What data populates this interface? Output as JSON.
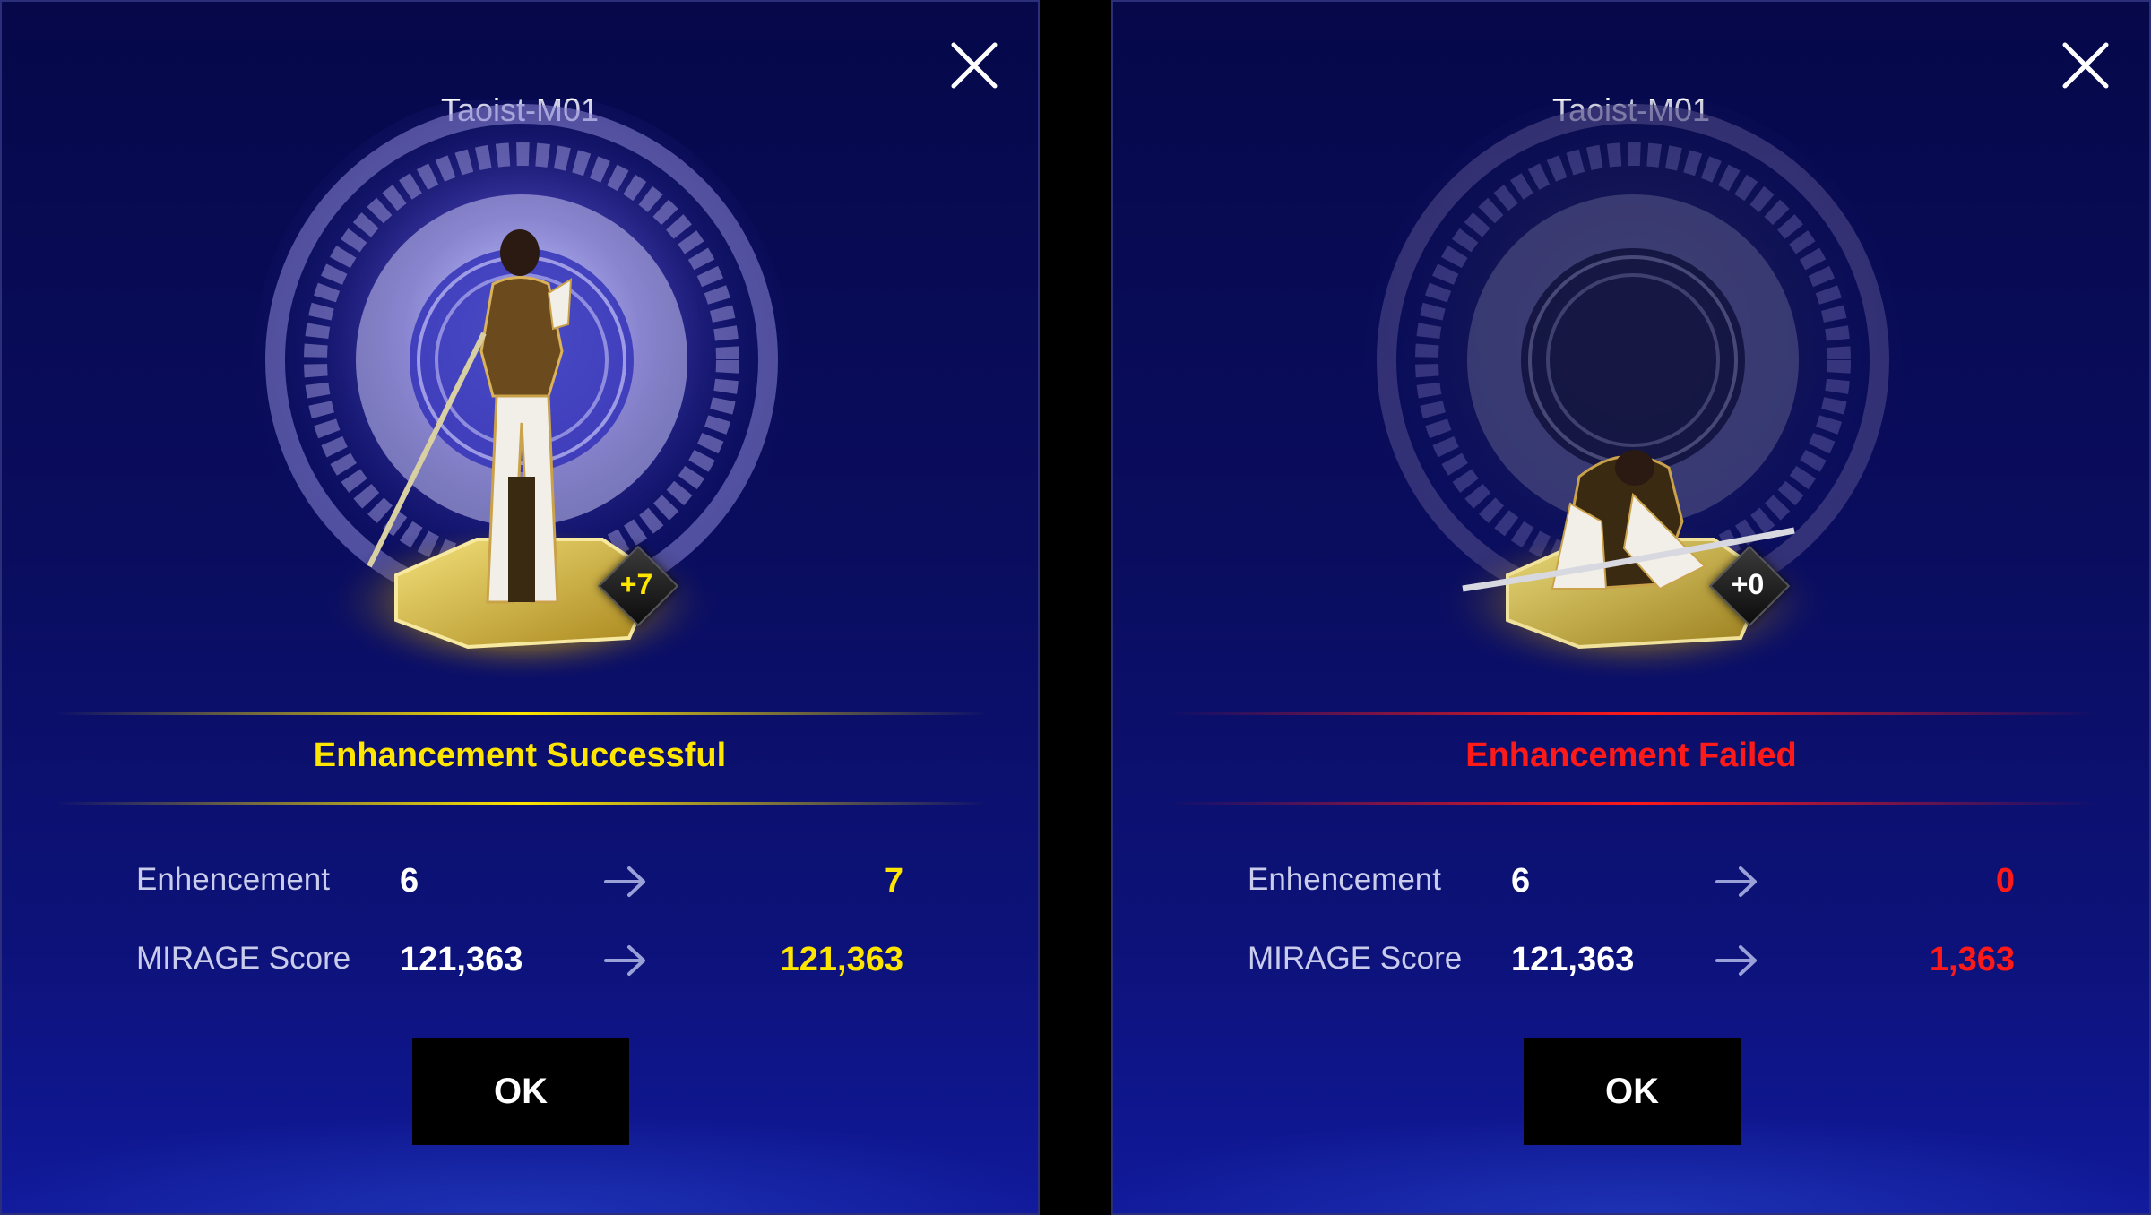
{
  "colors": {
    "success": "#ffe600",
    "failed": "#ff1a1a",
    "panel_bg": "#0a0d5e",
    "label": "#c9ccea"
  },
  "panels": [
    {
      "character_name": "Taoist-M01",
      "level_badge": "+7",
      "result_title": "Enhancement Successful",
      "result_color": "#ffe600",
      "stats": [
        {
          "label": "Enhencement",
          "from": "6",
          "to": "7"
        },
        {
          "label": "MIRAGE Score",
          "from": "121,363",
          "to": "121,363"
        }
      ],
      "ok_label": "OK",
      "close_icon": "close-icon"
    },
    {
      "character_name": "Taoist-M01",
      "level_badge": "+0",
      "result_title": "Enhancement Failed",
      "result_color": "#ff1a1a",
      "stats": [
        {
          "label": "Enhencement",
          "from": "6",
          "to": "0"
        },
        {
          "label": "MIRAGE Score",
          "from": "121,363",
          "to": "1,363"
        }
      ],
      "ok_label": "OK",
      "close_icon": "close-icon"
    }
  ]
}
